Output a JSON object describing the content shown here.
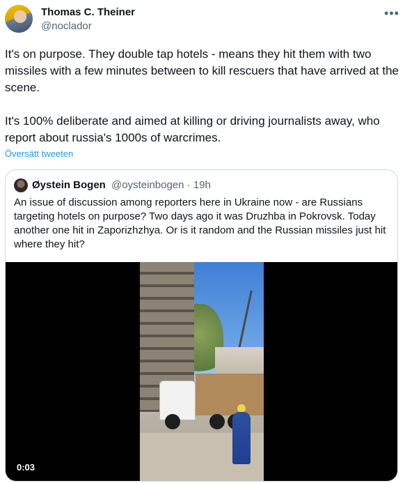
{
  "author": {
    "name": "Thomas C. Theiner",
    "handle": "@noclador"
  },
  "more_icon": "more-horizontal-icon",
  "tweet": {
    "text": "It's on purpose. They double tap hotels - means they hit them with two missiles with a few minutes between to kill rescuers that have arrived at the scene.\n\nIt's 100% deliberate and aimed at killing or driving journalists away, who report about russia's 1000s of warcrimes.",
    "translate_label": "Översätt tweeten"
  },
  "quote": {
    "name": "Øystein Bogen",
    "meta": "@oysteinbogen · 19h",
    "text": "An issue of discussion among reporters here in Ukraine now - are Russians targeting hotels on purpose? Two days ago it was Druzhba in Pokrovsk. Today another one hit in Zaporizhzhya. Or is it random and the Russian missiles just hit where they hit?",
    "video_time": "0:03"
  },
  "colors": {
    "accent": "#1d9bf0",
    "secondary_text": "#536471",
    "border": "#cfd9de"
  }
}
